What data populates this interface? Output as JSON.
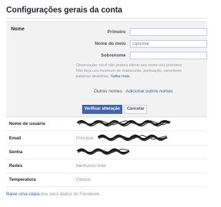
{
  "page": {
    "title": "Configurações gerais da conta"
  },
  "name_section": {
    "label": "Nome",
    "fields": [
      {
        "label": "Primeiro",
        "value": "",
        "placeholder": ""
      },
      {
        "label": "Nome do meio",
        "value": "",
        "placeholder": "Opcional"
      },
      {
        "label": "Sobrenome",
        "value": "",
        "placeholder": ""
      }
    ],
    "note_lines": [
      "Observação: você não poderá alterar seu nome nos próximos",
      "Não faça uso incomum de maiúsculas, pontuação, caracteres",
      "palavras aleatórias."
    ],
    "note_link": "Saiba mais",
    "other_names_label": "Outros nomes",
    "other_names_link": "Adicionar outros nomes",
    "save_label": "Verificar alteração",
    "cancel_label": "Cancelar"
  },
  "rows": {
    "username": {
      "label": "Nome de usuário"
    },
    "email": {
      "label": "Email",
      "prefix": "Principal:"
    },
    "password": {
      "label": "Senha"
    },
    "networks": {
      "label": "Redes",
      "value": "Nenhuma rede."
    },
    "temperature": {
      "label": "Temperatura",
      "value": "Celsius"
    }
  },
  "footer": {
    "link": "Baixe uma cópia",
    "text": "dos seus dados do Facebook."
  }
}
